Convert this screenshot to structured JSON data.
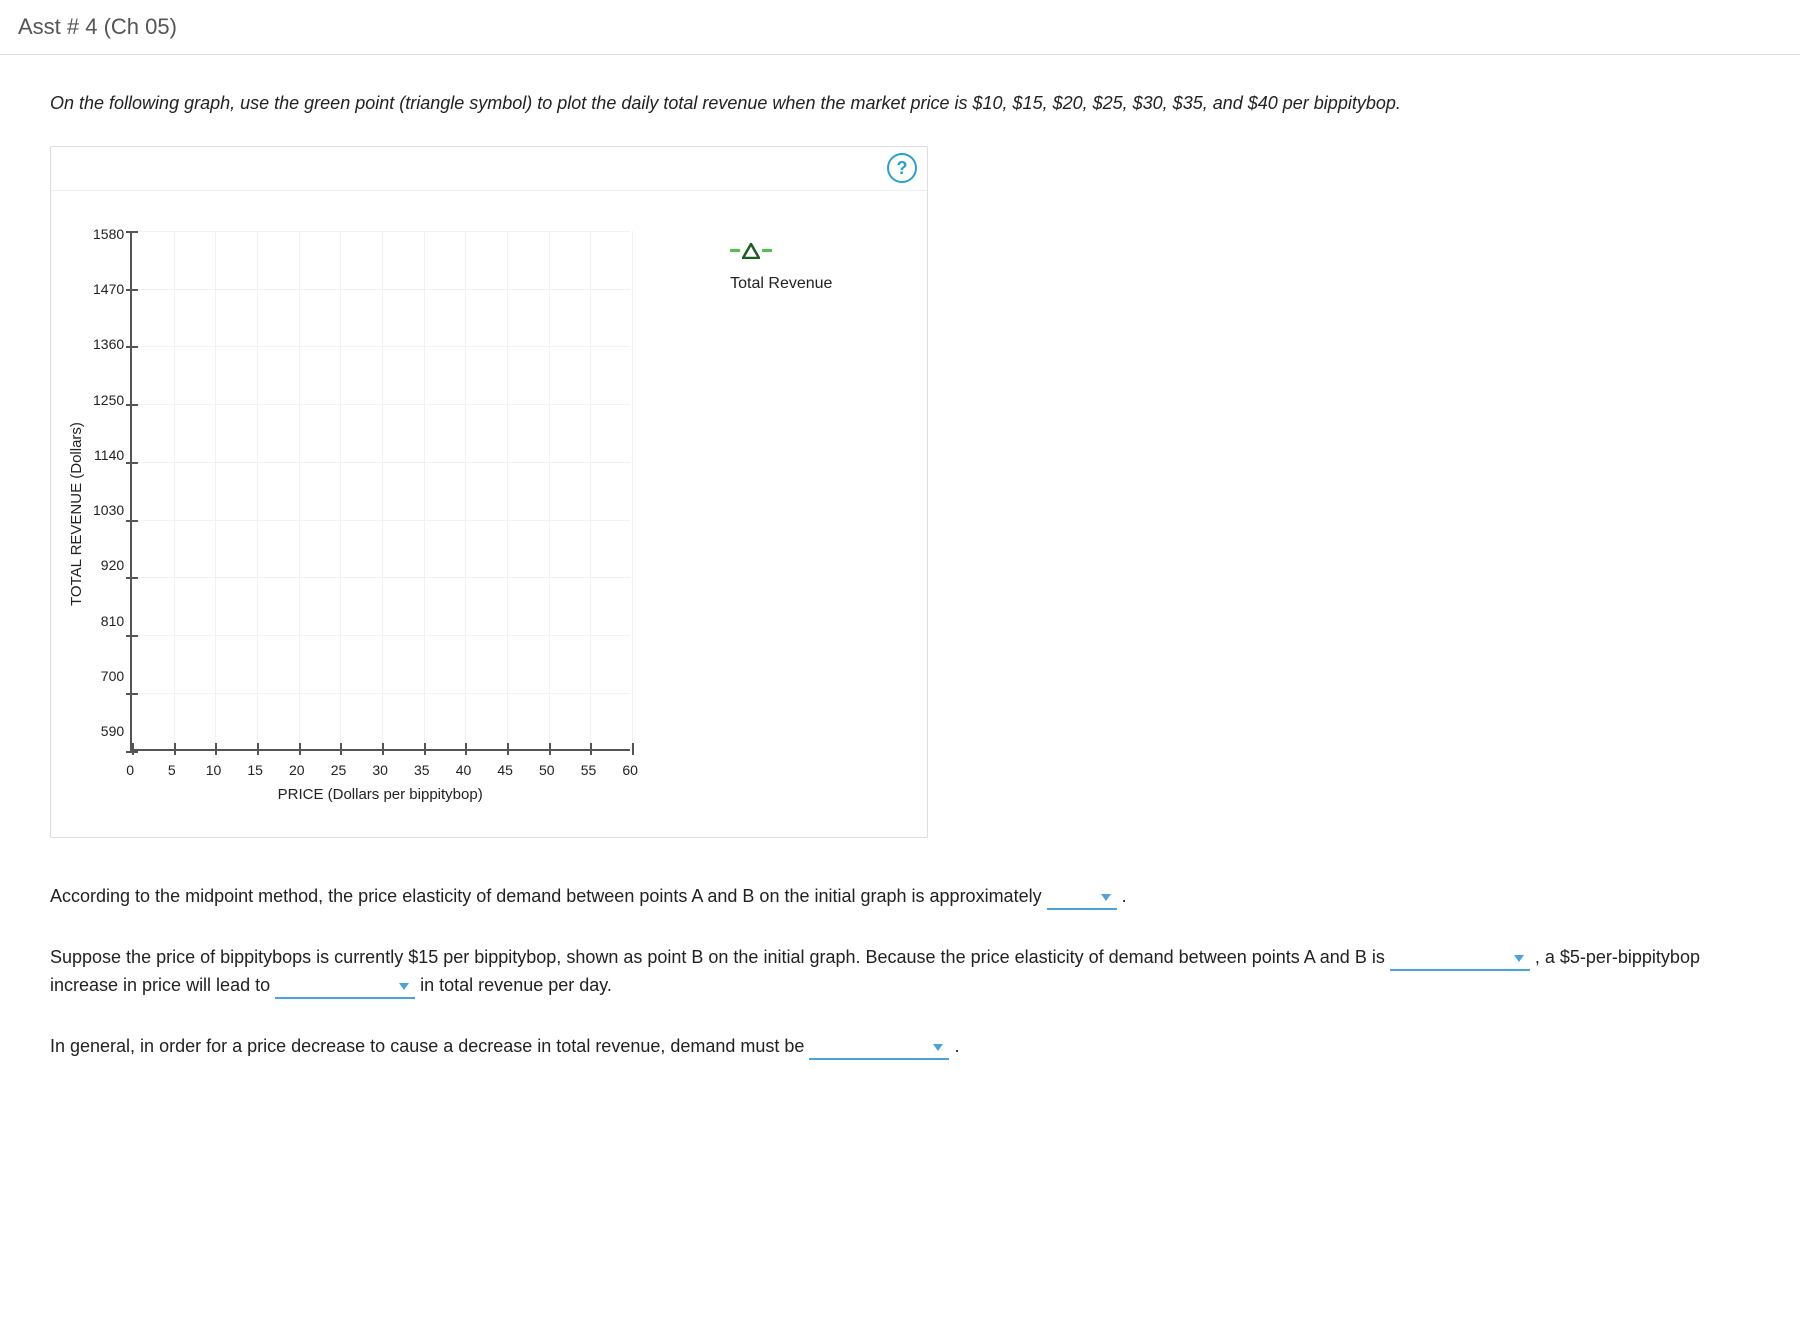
{
  "header": {
    "title": "Asst # 4 (Ch 05)"
  },
  "instructions": "On the following graph, use the green point (triangle symbol) to plot the daily total revenue when the market price is $10, $15, $20, $25, $30, $35, and $40 per bippitybop.",
  "graph": {
    "help_tooltip": "?",
    "legend": {
      "label": "Total Revenue"
    }
  },
  "chart_data": {
    "type": "scatter",
    "title": "",
    "xlabel": "PRICE (Dollars per bippitybop)",
    "ylabel": "TOTAL REVENUE (Dollars)",
    "x_ticks": [
      0,
      5,
      10,
      15,
      20,
      25,
      30,
      35,
      40,
      45,
      50,
      55,
      60
    ],
    "y_ticks": [
      590,
      700,
      810,
      920,
      1030,
      1140,
      1250,
      1360,
      1470,
      1580
    ],
    "xlim": [
      0,
      60
    ],
    "ylim": [
      590,
      1580
    ],
    "series": [
      {
        "name": "Total Revenue",
        "color": "#2e7d32",
        "symbol": "triangle",
        "points": []
      }
    ],
    "grid": true
  },
  "questions": {
    "q1_pre": "According to the midpoint method, the price elasticity of demand between points A and B on the initial graph is approximately",
    "q1_post": ".",
    "q2_pre": "Suppose the price of bippitybops is currently $15 per bippitybop, shown as point B on the initial graph. Because the price elasticity of demand between points A and B is",
    "q2_mid": ", a $5-per-bippitybop increase in price will lead to",
    "q2_post": "in total revenue per day.",
    "q3_pre": "In general, in order for a price decrease to cause a decrease in total revenue, demand must be",
    "q3_post": "."
  }
}
